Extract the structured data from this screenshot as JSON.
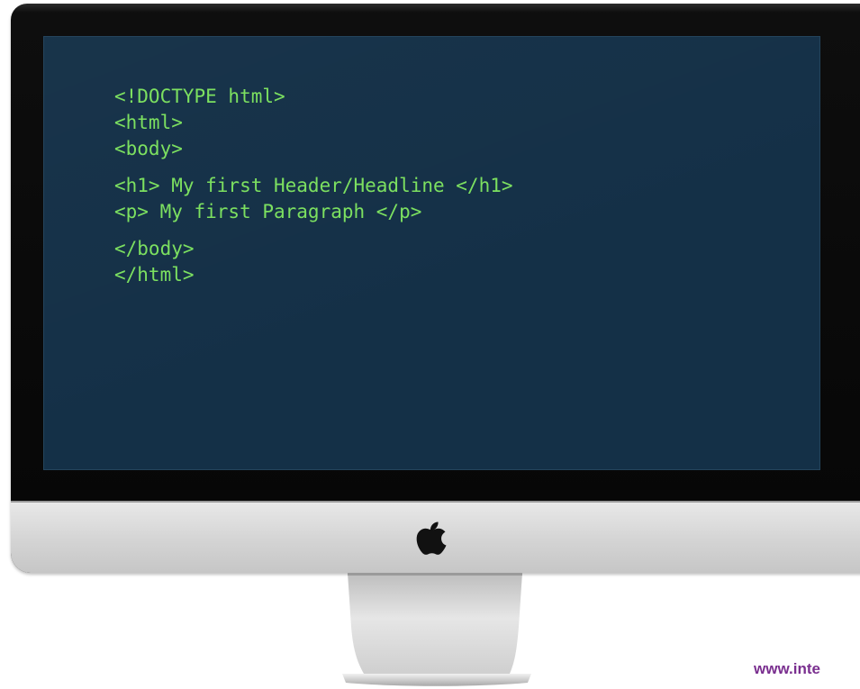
{
  "code": {
    "line1": "<!DOCTYPE html>",
    "line2": "<html>",
    "line3": "<body>",
    "line4": "<h1> My first Header/Headline </h1>",
    "line5": "<p> My first Paragraph </p>",
    "line6": "</body>",
    "line7": "</html>"
  },
  "footer": {
    "url": "www.inte"
  },
  "icons": {
    "logo": "apple-logo-icon"
  },
  "colors": {
    "screen_background": "#143047",
    "code_text": "#7ce060",
    "bezel": "#0a0a0a",
    "chin": "#d8d8d8",
    "url_text": "#7a2f8f"
  }
}
